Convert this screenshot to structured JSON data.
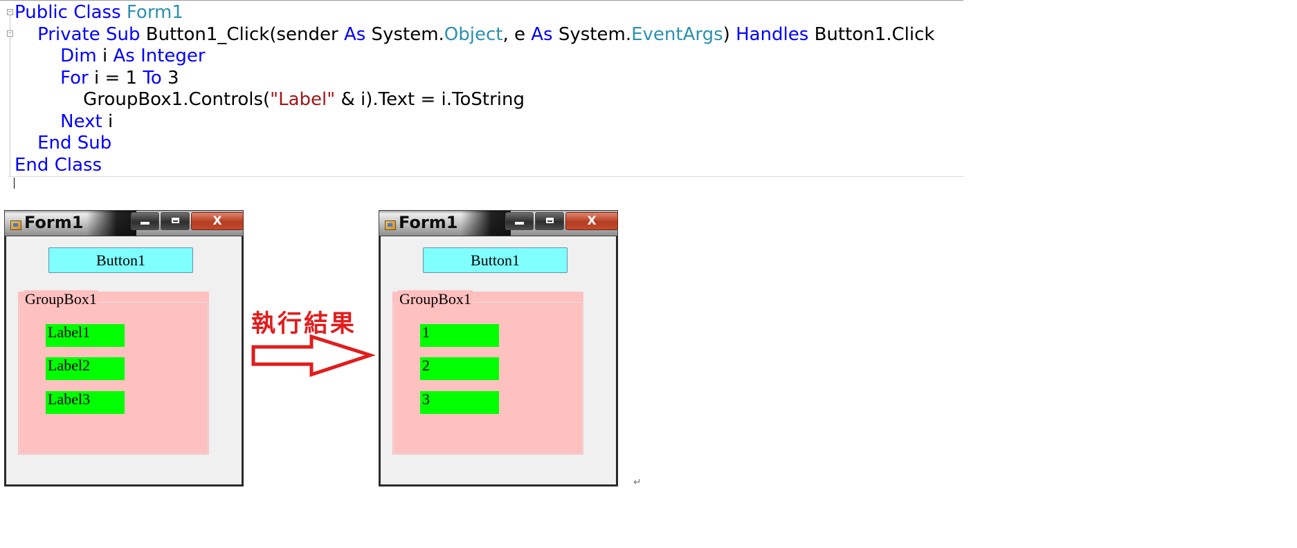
{
  "code": {
    "lines": [
      [
        {
          "t": "Public",
          "c": "kw"
        },
        {
          "t": " "
        },
        {
          "t": "Class",
          "c": "kw"
        },
        {
          "t": " "
        },
        {
          "t": "Form1",
          "c": "ty"
        }
      ],
      [
        {
          "t": "    "
        },
        {
          "t": "Private",
          "c": "kw"
        },
        {
          "t": " "
        },
        {
          "t": "Sub",
          "c": "kw"
        },
        {
          "t": " Button1_Click(sender "
        },
        {
          "t": "As",
          "c": "kw"
        },
        {
          "t": " System."
        },
        {
          "t": "Object",
          "c": "ty"
        },
        {
          "t": ", e "
        },
        {
          "t": "As",
          "c": "kw"
        },
        {
          "t": " System."
        },
        {
          "t": "EventArgs",
          "c": "ty"
        },
        {
          "t": ") "
        },
        {
          "t": "Handles",
          "c": "kw"
        },
        {
          "t": " Button1.Click"
        }
      ],
      [
        {
          "t": "        "
        },
        {
          "t": "Dim",
          "c": "kw"
        },
        {
          "t": " i "
        },
        {
          "t": "As",
          "c": "kw"
        },
        {
          "t": " "
        },
        {
          "t": "Integer",
          "c": "kw"
        }
      ],
      [
        {
          "t": "        "
        },
        {
          "t": "For",
          "c": "kw"
        },
        {
          "t": " i = 1 "
        },
        {
          "t": "To",
          "c": "kw"
        },
        {
          "t": " 3"
        }
      ],
      [
        {
          "t": "            GroupBox1.Controls("
        },
        {
          "t": "\"Label\"",
          "c": "st"
        },
        {
          "t": " & i).Text = i.ToString"
        }
      ],
      [
        {
          "t": "        "
        },
        {
          "t": "Next",
          "c": "kw"
        },
        {
          "t": " i"
        }
      ],
      [
        {
          "t": "    "
        },
        {
          "t": "End",
          "c": "kw"
        },
        {
          "t": " "
        },
        {
          "t": "Sub",
          "c": "kw"
        }
      ],
      [
        {
          "t": "End",
          "c": "kw"
        },
        {
          "t": " "
        },
        {
          "t": "Class",
          "c": "kw"
        }
      ]
    ],
    "fold_marks": [
      "⊟",
      "⊟"
    ]
  },
  "forms": {
    "before": {
      "title": "Form1",
      "button_label": "Button1",
      "groupbox_caption": "GroupBox1",
      "labels": [
        "Label1",
        "Label2",
        "Label3"
      ]
    },
    "after": {
      "title": "Form1",
      "button_label": "Button1",
      "groupbox_caption": "GroupBox1",
      "labels": [
        "1",
        "2",
        "3"
      ]
    },
    "close_glyph": "X"
  },
  "annotation": {
    "result_text": "執行結果",
    "arrow_color": "#e21c1c"
  },
  "paragraph_mark": "↵",
  "colors": {
    "keyword": "#0000ff",
    "type": "#2b91af",
    "string": "#a31515",
    "button_bg": "#80ffff",
    "groupbox_bg": "#ffc0c0",
    "label_bg": "#00ff00"
  }
}
